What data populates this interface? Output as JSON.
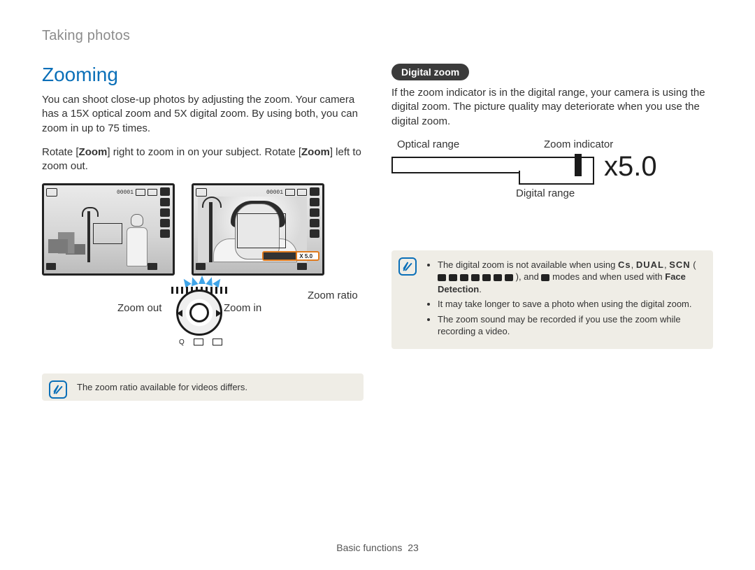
{
  "breadcrumb": "Taking photos",
  "section_title": "Zooming",
  "intro": "You can shoot close-up photos by adjusting the zoom. Your camera has a 15X optical zoom and 5X digital zoom. By using both, you can zoom in up to 75 times.",
  "rotate_instruction_pre": "Rotate [",
  "rotate_instruction_b1": "Zoom",
  "rotate_instruction_mid": "] right to zoom in on your subject. Rotate [",
  "rotate_instruction_b2": "Zoom",
  "rotate_instruction_post": "] left to zoom out.",
  "lcd_wide": {
    "counter": "00001"
  },
  "lcd_tele": {
    "counter": "00001",
    "zoom_strip_text": "X 5.0"
  },
  "dial": {
    "zoom_out": "Zoom out",
    "zoom_in": "Zoom in",
    "zoom_ratio": "Zoom ratio"
  },
  "note_left": "The zoom ratio available for videos differs.",
  "right": {
    "pill": "Digital zoom",
    "desc": "If the zoom indicator is in the digital range, your camera is using the digital zoom. The picture quality may deteriorate when you use the digital zoom.",
    "labels": {
      "optical": "Optical range",
      "indicator": "Zoom indicator",
      "digital": "Digital range",
      "x5": "x5.0"
    },
    "note_items": [
      "The digital zoom is not available when using ",
      " modes and when used with ",
      "Face Detection",
      ".",
      "It may take longer to save a photo when using the digital zoom.",
      "The zoom sound may be recorded if you use the zoom while recording a video."
    ],
    "mode_text_tail": "), and ",
    "mode_hint_cs": "Cs",
    "mode_hint_dual": "DUAL",
    "mode_hint_scn": "SCN"
  },
  "footer": {
    "section": "Basic functions",
    "page": "23"
  }
}
